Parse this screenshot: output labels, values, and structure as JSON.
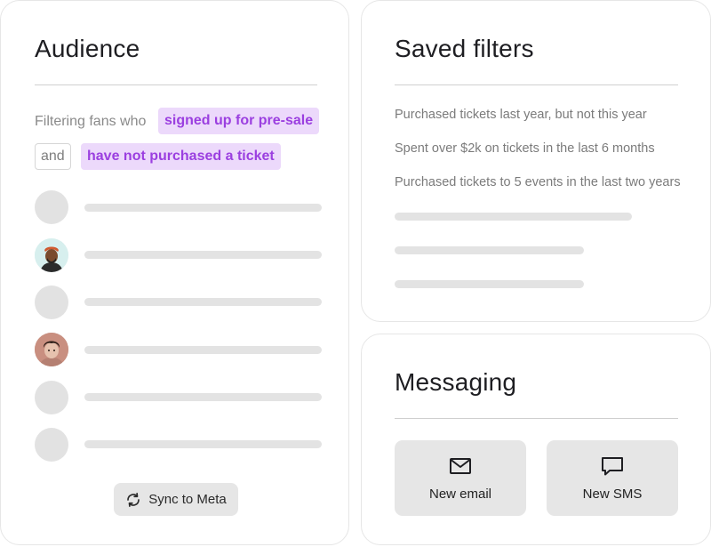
{
  "audience": {
    "title": "Audience",
    "filter_prefix": "Filtering fans who",
    "filter_condition_1": "signed up for pre-sale",
    "conjunction": "and",
    "filter_condition_2": "have not purchased a ticket",
    "sync_button_label": "Sync to Meta",
    "sync_icon": "sync-icon"
  },
  "saved_filters": {
    "title": "Saved filters",
    "items": [
      "Purchased tickets last year, but not this year",
      "Spent over $2k on tickets in the last 6 months",
      "Purchased tickets to 5 events in the last two years"
    ]
  },
  "messaging": {
    "title": "Messaging",
    "buttons": [
      {
        "label": "New email",
        "icon": "mail-icon"
      },
      {
        "label": "New SMS",
        "icon": "chat-bubble-icon"
      }
    ]
  },
  "colors": {
    "chip_bg": "#ecd9fb",
    "chip_text": "#9b3fe0",
    "skeleton": "#e3e3e3",
    "button_bg": "#e6e6e6"
  }
}
